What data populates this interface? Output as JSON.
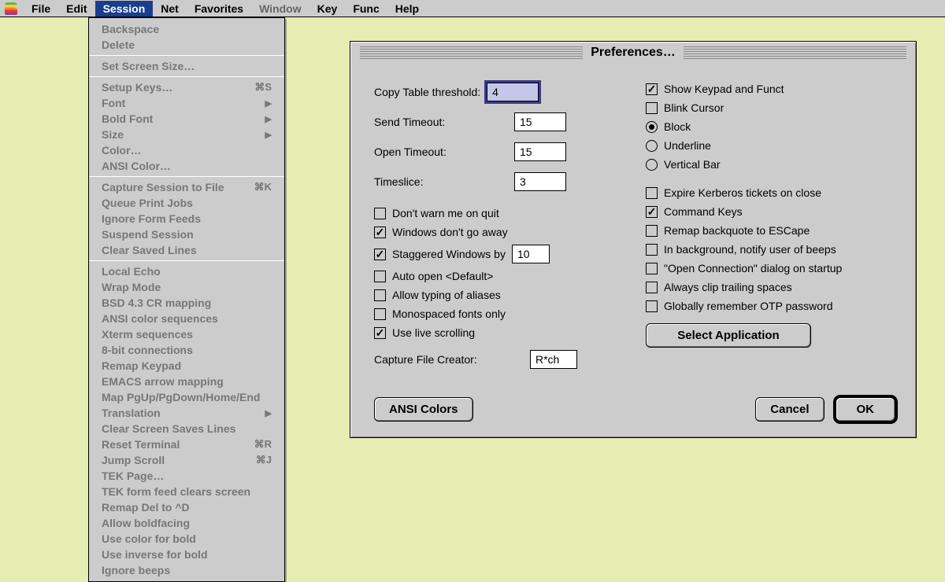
{
  "menubar": {
    "items": [
      {
        "label": "File",
        "enabled": true
      },
      {
        "label": "Edit",
        "enabled": true
      },
      {
        "label": "Session",
        "enabled": true,
        "selected": true
      },
      {
        "label": "Net",
        "enabled": true
      },
      {
        "label": "Favorites",
        "enabled": true
      },
      {
        "label": "Window",
        "enabled": false
      },
      {
        "label": "Key",
        "enabled": true
      },
      {
        "label": "Func",
        "enabled": true
      },
      {
        "label": "Help",
        "enabled": true
      }
    ]
  },
  "dropdown": {
    "groups": [
      [
        {
          "label": "Backspace"
        },
        {
          "label": "Delete"
        }
      ],
      [
        {
          "label": "Set Screen Size…"
        }
      ],
      [
        {
          "label": "Setup Keys…",
          "shortcut": "⌘S"
        },
        {
          "label": "Font",
          "submenu": true
        },
        {
          "label": "Bold Font",
          "submenu": true
        },
        {
          "label": "Size",
          "submenu": true
        },
        {
          "label": "Color…"
        },
        {
          "label": "ANSI Color…"
        }
      ],
      [
        {
          "label": "Capture Session to File",
          "shortcut": "⌘K"
        },
        {
          "label": "Queue Print Jobs"
        },
        {
          "label": "Ignore Form Feeds"
        },
        {
          "label": "Suspend Session"
        },
        {
          "label": "Clear Saved Lines"
        }
      ],
      [
        {
          "label": "Local Echo"
        },
        {
          "label": "Wrap Mode"
        },
        {
          "label": "BSD 4.3 CR mapping"
        },
        {
          "label": "ANSI color sequences"
        },
        {
          "label": "Xterm sequences"
        },
        {
          "label": "8-bit connections"
        },
        {
          "label": "Remap Keypad"
        },
        {
          "label": "EMACS arrow mapping"
        },
        {
          "label": "Map PgUp/PgDown/Home/End"
        },
        {
          "label": "Translation",
          "submenu": true
        },
        {
          "label": "Clear Screen Saves Lines"
        },
        {
          "label": "Reset Terminal",
          "shortcut": "⌘R"
        },
        {
          "label": "Jump Scroll",
          "shortcut": "⌘J"
        },
        {
          "label": "TEK Page…"
        },
        {
          "label": "TEK form feed clears screen"
        },
        {
          "label": "Remap Del to ^D"
        },
        {
          "label": "Allow boldfacing"
        },
        {
          "label": "Use color for bold"
        },
        {
          "label": "Use inverse for bold"
        },
        {
          "label": "Ignore beeps"
        }
      ]
    ]
  },
  "prefs": {
    "title": "Preferences…",
    "left": {
      "copy_table_label": "Copy Table threshold:",
      "copy_table_value": "4",
      "send_timeout_label": "Send Timeout:",
      "send_timeout_value": "15",
      "open_timeout_label": "Open Timeout:",
      "open_timeout_value": "15",
      "timeslice_label": "Timeslice:",
      "timeslice_value": "3",
      "chk_dont_warn": "Don't warn me on quit",
      "chk_windows_dont_go": "Windows don't go away",
      "chk_staggered": "Staggered Windows by",
      "staggered_value": "10",
      "chk_auto_open": "Auto open <Default>",
      "chk_allow_aliases": "Allow typing of aliases",
      "chk_mono_fonts": "Monospaced fonts only",
      "chk_live_scroll": "Use live scrolling",
      "capture_label": "Capture File Creator:",
      "capture_value": "R*ch"
    },
    "right": {
      "chk_show_keypad": "Show Keypad and Funct",
      "chk_blink": "Blink Cursor",
      "radio_block": "Block",
      "radio_underline": "Underline",
      "radio_vbar": "Vertical Bar",
      "chk_expire": "Expire Kerberos tickets on close",
      "chk_cmdkeys": "Command Keys",
      "chk_remap_bq": "Remap backquote to ESCape",
      "chk_bg_beeps": "In background, notify user of beeps",
      "chk_open_conn": "\"Open Connection\" dialog on startup",
      "chk_clip_trail": "Always clip trailing spaces",
      "chk_otp": "Globally remember OTP password"
    },
    "buttons": {
      "ansi": "ANSI Colors",
      "select_app": "Select Application",
      "cancel": "Cancel",
      "ok": "OK"
    }
  }
}
